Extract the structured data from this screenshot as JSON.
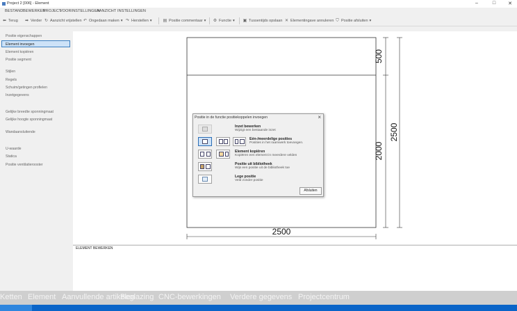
{
  "window": {
    "title": "Project 2 [006] - Element",
    "controls": [
      "–",
      "□",
      "✕"
    ]
  },
  "menu": [
    "BESTAND",
    "BEWERKEN",
    "PROJECT",
    "VOORINSTELLINGEN",
    "AANZICHT",
    "INSTELLINGEN"
  ],
  "toolbar": {
    "back": "Terug",
    "forward": "Verder",
    "refresh": "Aanzicht vrijstellen",
    "undo": "Ongedaan maken",
    "redo": "Herstellen",
    "commentary": "Positie commentaar",
    "function": "Functie",
    "save_between": "Tussentijds opslaan",
    "cancel_input": "Elementingave annuleren",
    "close_position": "Positie afsluiten"
  },
  "sidebar": {
    "items": [
      {
        "label": "Positie eigenschappen",
        "selected": false
      },
      {
        "label": "Element invoegen",
        "selected": true
      },
      {
        "label": "Element kopiëren",
        "selected": false
      },
      {
        "label": "Positie segment",
        "selected": false
      },
      {
        "label": "Stijlen",
        "selected": false
      },
      {
        "label": "Regels",
        "selected": false
      },
      {
        "label": "Schuim/getingen profielen",
        "selected": false
      },
      {
        "label": "Inzetgegevens",
        "selected": false
      },
      {
        "label": "Gelijke breedte sponningmaat",
        "selected": false
      },
      {
        "label": "Gelijke hoogte sponningmaat",
        "selected": false
      },
      {
        "label": "Wandaansluitende",
        "selected": false
      },
      {
        "label": "U-waarde",
        "selected": false
      },
      {
        "label": "Statica",
        "selected": false
      },
      {
        "label": "Positie ventilatierooster",
        "selected": false
      }
    ]
  },
  "drawing": {
    "dim_top": "500",
    "dim_mid": "2000",
    "dim_total_height": "2500",
    "dim_width": "2500"
  },
  "dialog": {
    "title": "Positie in de functie positiekoppelen invoegen",
    "options": [
      {
        "title": "Inzet bewerken",
        "desc": "Wijzigt een bestaande inzet"
      },
      {
        "title": "Eén-/meerdelige posities",
        "desc": "Posities in het raamwerk toevoegen."
      },
      {
        "title": "Element kopiëren",
        "desc": "Kopiëren een element in meerdere velden"
      },
      {
        "title": "Positie uit bibliotheek",
        "desc": "Wijs een positie uit de bibliotheek toe"
      },
      {
        "title": "Lege positie",
        "desc": "Veld zonder positie"
      }
    ],
    "close_button": "Afsluiten"
  },
  "bottom_pane": {
    "label": "ELEMENT BEWERKEN"
  },
  "bottom_nav": [
    "Ketten",
    "Element",
    "Aanvullende artikelen",
    "Beglazing",
    "CNC-bewerkingen",
    "Verdere gegevens",
    "Projectcentrum"
  ],
  "colors": {
    "accent": "#0a64c8",
    "selection": "#cde2f7"
  }
}
